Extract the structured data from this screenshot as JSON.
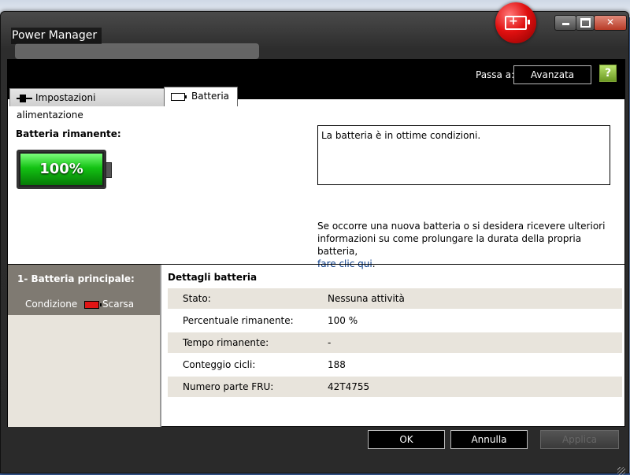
{
  "window": {
    "title": "Power Manager",
    "controls": {
      "minimize": "minimize",
      "maximize": "maximize",
      "close": "✕"
    }
  },
  "header": {
    "passa_label": "Passa a:",
    "avanzata_label": "Avanzata",
    "help_label": "?"
  },
  "tabs": [
    {
      "label": "Impostazioni alimentazione",
      "icon": "power-plug-icon"
    },
    {
      "label": "Batteria",
      "icon": "battery-icon"
    }
  ],
  "battery": {
    "remaining_label": "Batteria rimanente:",
    "percent_text": "100%",
    "fill_fraction": 1.0,
    "status_message": "La batteria è in ottime condizioni.",
    "info_text": "Se occorre una nuova batteria o si desidera ricevere ulteriori informazioni su come prolungare la durata della propria batteria,",
    "info_link": "fare clic qui",
    "info_end": "."
  },
  "left_panel": {
    "title": "1- Batteria principale:",
    "condition_label": "Condizione",
    "condition_value": "Scarsa"
  },
  "details": {
    "title": "Dettagli batteria",
    "rows": [
      {
        "key": "Stato:",
        "value": "Nessuna attività"
      },
      {
        "key": "Percentuale rimanente:",
        "value": "100 %"
      },
      {
        "key": "Tempo rimanente:",
        "value": "-"
      },
      {
        "key": "Conteggio cicli:",
        "value": "188"
      },
      {
        "key": "Numero parte FRU:",
        "value": "42T4755"
      }
    ]
  },
  "footer": {
    "ok": "OK",
    "annulla": "Annulla",
    "applica": "Applica"
  },
  "colors": {
    "battery_green": "#13c213",
    "condition_red": "#e01515",
    "link_blue": "#0d3f8a"
  }
}
